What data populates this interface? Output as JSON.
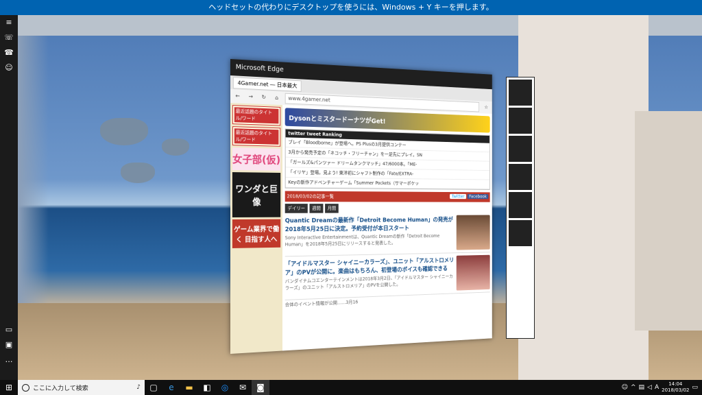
{
  "banner": {
    "text": "ヘッドセットの代わりにデスクトップを使うには、Windows + Y キーを押します。"
  },
  "sidebar": {
    "items": [
      {
        "icon": "menu-icon"
      },
      {
        "icon": "phone-icon"
      },
      {
        "icon": "voice-icon"
      },
      {
        "icon": "people-icon"
      },
      {
        "icon": "photo-icon"
      },
      {
        "icon": "store-icon"
      },
      {
        "icon": "more-icon",
        "glyph": "…"
      }
    ]
  },
  "browser": {
    "title": "Microsoft Edge",
    "tab_label": "4Gamer.net ― 日本最大",
    "address": "www.4gamer.net",
    "ad_text": "DysonとミスタードーナツがGet!",
    "side": {
      "box1_head": "最近話題のタイトル/ワード",
      "box2_head": "最近話題のタイトル/ワード",
      "joshi": "女子部(仮)",
      "wanda": "ワンダと巨像",
      "gyokai": "ゲーム業界で働く 目指す人へ"
    },
    "twitter_head": "twitter tweet Ranking",
    "tweets": [
      "ブレイ「Bloodborne」が登場へ。PS Plusの3月提供コンテー",
      "3月から発売予定の「ネコッチ・フリーチャン」を一足先にプレイ。SN",
      "「ガールズ&パンツァー ドリームタンクマッチ」47/6000本。「ME-",
      "「イリヤ」登場。見よう! 東洋初にシャフト制作の「Fate/EXTRA-",
      "Keyの新作アドベンチャーゲーム「Summer Pockets（サマーポケッ"
    ],
    "datebar": {
      "left": "2018/03/02の記事一覧",
      "twitter": "Twitter",
      "facebook": "Facebook"
    },
    "nav_tabs": [
      "デイリー",
      "週間",
      "月間"
    ],
    "articles": [
      {
        "title": "Quantic Dreamの最新作「Detroit Become Human」の発売が2018年5月25日に決定。予約受付が本日スタート",
        "body": "Sony Interactive Entertainmentは、Quantic Dreamの新作「Detroit Become Human」を2018年5月25日にリリースすると発表した。"
      },
      {
        "title": "「アイドルマスター シャイニーカラーズ」、ユニット「アルストロメリア」のPVが公開に。楽曲はもちろん、初登場のボイスも確認できる",
        "body": "バンダイナムコエンターテインメントは2018年3月2日、「アイドルマスター シャイニーカラーズ」のユニット「アルストロメリア」のPVを公開した。"
      }
    ],
    "next_teaser": "合体のイベント情報が公開……3月16"
  },
  "taskbar": {
    "search_placeholder": "ここに入力して検索",
    "ime": "A",
    "time": "14:04",
    "date": "2018/03/02"
  }
}
